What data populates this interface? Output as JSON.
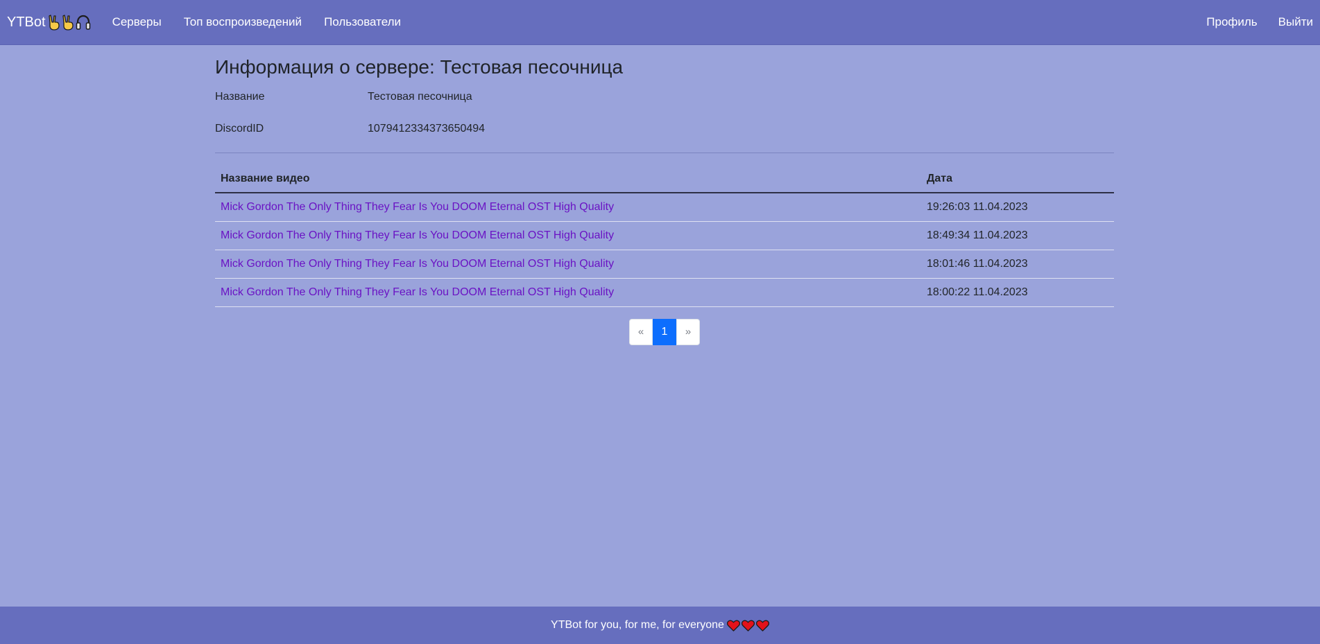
{
  "navbar": {
    "brand": "YTBot",
    "brand_icons": [
      "victory-hand-icon",
      "victory-hand-icon",
      "headphones-icon"
    ],
    "links": [
      "Серверы",
      "Топ воспроизведений",
      "Пользователи"
    ],
    "right_links": [
      "Профиль",
      "Выйти"
    ]
  },
  "page": {
    "title": "Информация о сервере: Тестовая песочница",
    "info": [
      {
        "label": "Название",
        "value": "Тестовая песочница"
      },
      {
        "label": "DiscordID",
        "value": "1079412334373650494"
      }
    ]
  },
  "table": {
    "headers": [
      "Название видео",
      "Дата"
    ],
    "rows": [
      {
        "title": "Mick Gordon The Only Thing They Fear Is You DOOM Eternal OST High Quality",
        "date": "19:26:03 11.04.2023"
      },
      {
        "title": "Mick Gordon The Only Thing They Fear Is You DOOM Eternal OST High Quality",
        "date": "18:49:34 11.04.2023"
      },
      {
        "title": "Mick Gordon The Only Thing They Fear Is You DOOM Eternal OST High Quality",
        "date": "18:01:46 11.04.2023"
      },
      {
        "title": "Mick Gordon The Only Thing They Fear Is You DOOM Eternal OST High Quality",
        "date": "18:00:22 11.04.2023"
      }
    ]
  },
  "pagination": {
    "prev": "«",
    "current": "1",
    "next": "»"
  },
  "footer": {
    "text": "YTBot for you, for me, for everyone",
    "icons": [
      "heart-icon",
      "heart-icon",
      "heart-icon"
    ]
  },
  "colors": {
    "navbar": "#666ebe",
    "background": "#9aa3db",
    "link": "#6a13c4",
    "active_page": "#0d6efd"
  }
}
